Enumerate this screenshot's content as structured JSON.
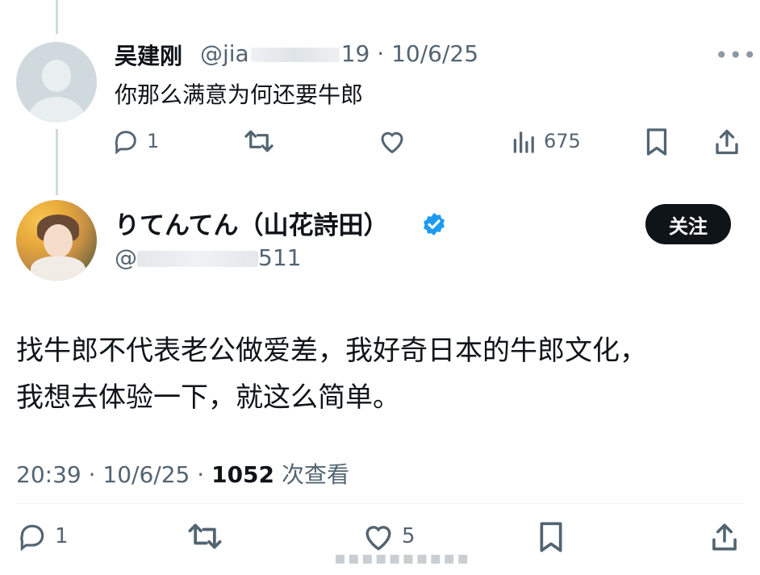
{
  "reply": {
    "author_name": "吴建刚",
    "handle_prefix": "@jia",
    "handle_suffix": "19",
    "date": "10/6/25",
    "separator": "·",
    "text": "你那么满意为何还要牛郎",
    "more_icon": "more-dots-icon",
    "stats": {
      "replies": "1",
      "reposts": "",
      "likes": "",
      "views": "675"
    }
  },
  "main_post": {
    "author_name": "りてんてん（山花詩田）",
    "verified_icon": "verified-badge-icon",
    "handle_prefix": "@",
    "handle_suffix": "511",
    "follow_label": "关注",
    "text_lines": [
      "找牛郎不代表老公做爱差，我好奇日本的牛郎文化，",
      "我想去体验一下，就这么简单。"
    ],
    "time": "20:39",
    "date": "10/6/25",
    "separator": "·",
    "views_count": "1052",
    "views_label": "次查看",
    "stats": {
      "replies": "1",
      "reposts": "",
      "likes": "5"
    }
  },
  "colors": {
    "primary_text": "#0f1419",
    "secondary_text": "#536471",
    "verified_blue": "#1d9bf0",
    "follow_button_bg": "#0f1419",
    "thread_line": "#cfd9de"
  }
}
